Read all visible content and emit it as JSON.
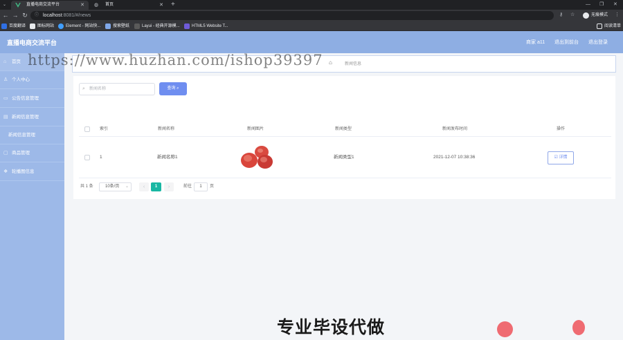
{
  "browser": {
    "tabs": [
      {
        "title": "直播电商交流平台",
        "active": true
      },
      {
        "title": "首页",
        "active": false
      }
    ],
    "url_host": "localhost",
    "url_path": ":8081/#/news",
    "profile_label": "无痕模式",
    "bookmarks": [
      "百度翻译",
      "图标网站",
      "Element - 网站快...",
      "搜索壁纸",
      "Layui - 经典开源模...",
      "HTML5 Website T..."
    ],
    "reading_list": "阅读清单"
  },
  "app": {
    "title": "直播电商交流平台",
    "header_links": {
      "user": "商家 a11",
      "backend": "退出到前台",
      "logout": "退出登录"
    },
    "sidebar": [
      {
        "label": "首页",
        "icon": "home-icon"
      },
      {
        "label": "个人中心",
        "icon": "user-icon"
      },
      {
        "label": "公告信息管理",
        "icon": "notice-icon"
      },
      {
        "label": "新闻信息管理",
        "icon": "news-icon"
      },
      {
        "label": "新闻信息管理",
        "icon": ""
      },
      {
        "label": "商品管理",
        "icon": "goods-icon"
      },
      {
        "label": "轮播图信息",
        "icon": "carousel-icon"
      }
    ],
    "breadcrumb": {
      "current": "新闻信息"
    },
    "search": {
      "placeholder": "新闻名称",
      "button_label": "查询"
    },
    "table": {
      "headers": [
        "索引",
        "新闻名称",
        "新闻图片",
        "新闻类型",
        "新闻发布时间",
        "操作"
      ],
      "rows": [
        {
          "index": "1",
          "name": "新闻名称1",
          "type": "新闻类型1",
          "time": "2021-12-07 10:38:36",
          "action": "详情"
        }
      ]
    },
    "pagination": {
      "total": "共 1 条",
      "page_size": "10条/页",
      "current": "1",
      "goto_label": "前往",
      "goto_value": "1",
      "page_suffix": "页"
    }
  },
  "overlays": {
    "watermark": "https://www.huzhan.com/ishop39397",
    "caption": "专业毕设代做"
  },
  "colors": {
    "header_bg": "#8eaee3",
    "sidebar_bg": "#9db9e8",
    "primary_button": "#6f8ef0",
    "pager_active": "#19b7a3"
  }
}
